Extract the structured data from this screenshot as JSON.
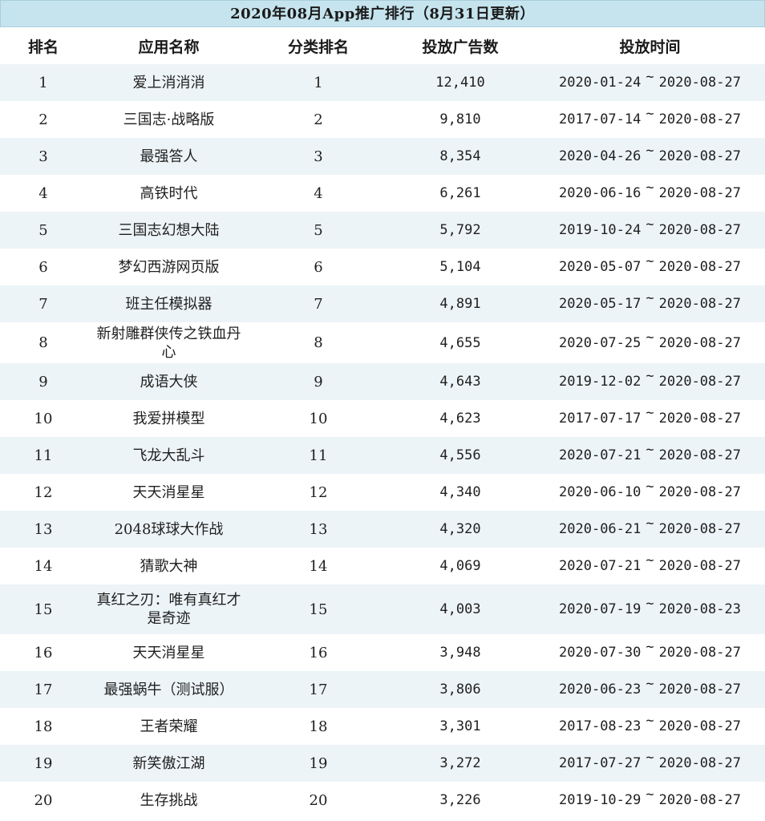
{
  "title": "2020年08月App推广排行（8月31日更新）",
  "headers": {
    "rank": "排名",
    "name": "应用名称",
    "category_rank": "分类排名",
    "ad_count": "投放广告数",
    "time": "投放时间"
  },
  "separator": "~",
  "rows": [
    {
      "rank": "1",
      "name": "爱上消消消",
      "category_rank": "1",
      "ad_count": "12,410",
      "start": "2020-01-24",
      "end": "2020-08-27"
    },
    {
      "rank": "2",
      "name": "三国志·战略版",
      "category_rank": "2",
      "ad_count": "9,810",
      "start": "2017-07-14",
      "end": "2020-08-27"
    },
    {
      "rank": "3",
      "name": "最强答人",
      "category_rank": "3",
      "ad_count": "8,354",
      "start": "2020-04-26",
      "end": "2020-08-27"
    },
    {
      "rank": "4",
      "name": "高铁时代",
      "category_rank": "4",
      "ad_count": "6,261",
      "start": "2020-06-16",
      "end": "2020-08-27"
    },
    {
      "rank": "5",
      "name": "三国志幻想大陆",
      "category_rank": "5",
      "ad_count": "5,792",
      "start": "2019-10-24",
      "end": "2020-08-27"
    },
    {
      "rank": "6",
      "name": "梦幻西游网页版",
      "category_rank": "6",
      "ad_count": "5,104",
      "start": "2020-05-07",
      "end": "2020-08-27"
    },
    {
      "rank": "7",
      "name": "班主任模拟器",
      "category_rank": "7",
      "ad_count": "4,891",
      "start": "2020-05-17",
      "end": "2020-08-27"
    },
    {
      "rank": "8",
      "name": "新射雕群侠传之铁血丹心",
      "category_rank": "8",
      "ad_count": "4,655",
      "start": "2020-07-25",
      "end": "2020-08-27"
    },
    {
      "rank": "9",
      "name": "成语大侠",
      "category_rank": "9",
      "ad_count": "4,643",
      "start": "2019-12-02",
      "end": "2020-08-27"
    },
    {
      "rank": "10",
      "name": "我爱拼模型",
      "category_rank": "10",
      "ad_count": "4,623",
      "start": "2017-07-17",
      "end": "2020-08-27"
    },
    {
      "rank": "11",
      "name": "飞龙大乱斗",
      "category_rank": "11",
      "ad_count": "4,556",
      "start": "2020-07-21",
      "end": "2020-08-27"
    },
    {
      "rank": "12",
      "name": "天天消星星",
      "category_rank": "12",
      "ad_count": "4,340",
      "start": "2020-06-10",
      "end": "2020-08-27"
    },
    {
      "rank": "13",
      "name": "2048球球大作战",
      "category_rank": "13",
      "ad_count": "4,320",
      "start": "2020-06-21",
      "end": "2020-08-27"
    },
    {
      "rank": "14",
      "name": "猜歌大神",
      "category_rank": "14",
      "ad_count": "4,069",
      "start": "2020-07-21",
      "end": "2020-08-27"
    },
    {
      "rank": "15",
      "name": "真红之刃：唯有真红才是奇迹",
      "category_rank": "15",
      "ad_count": "4,003",
      "start": "2020-07-19",
      "end": "2020-08-23"
    },
    {
      "rank": "16",
      "name": "天天消星星",
      "category_rank": "16",
      "ad_count": "3,948",
      "start": "2020-07-30",
      "end": "2020-08-27"
    },
    {
      "rank": "17",
      "name": "最强蜗牛（测试服）",
      "category_rank": "17",
      "ad_count": "3,806",
      "start": "2020-06-23",
      "end": "2020-08-27"
    },
    {
      "rank": "18",
      "name": "王者荣耀",
      "category_rank": "18",
      "ad_count": "3,301",
      "start": "2017-08-23",
      "end": "2020-08-27"
    },
    {
      "rank": "19",
      "name": "新笑傲江湖",
      "category_rank": "19",
      "ad_count": "3,272",
      "start": "2017-07-27",
      "end": "2020-08-27"
    },
    {
      "rank": "20",
      "name": "生存挑战",
      "category_rank": "20",
      "ad_count": "3,226",
      "start": "2019-10-29",
      "end": "2020-08-27"
    }
  ]
}
